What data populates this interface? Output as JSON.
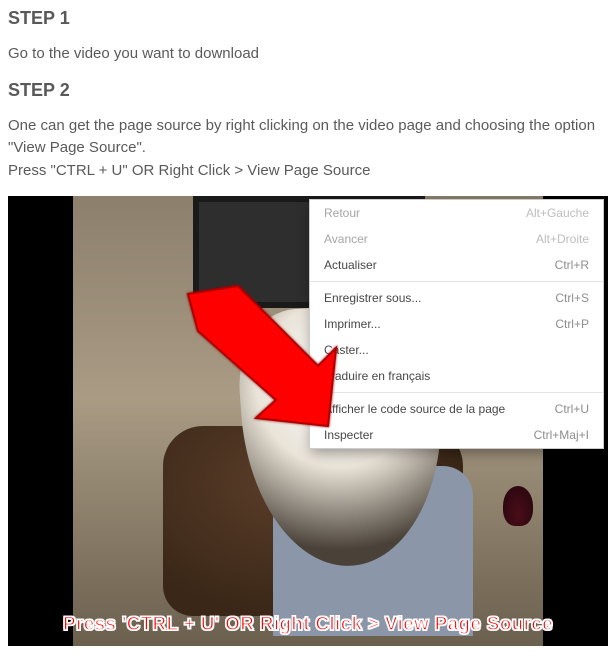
{
  "step1": {
    "heading": "STEP 1",
    "text": "Go to the video you want to download"
  },
  "step2": {
    "heading": "STEP 2",
    "text1": "One can get the page source by right clicking on the video page and choosing the option \"View Page Source\".",
    "text2": "Press \"CTRL + U\" OR Right Click > View Page Source"
  },
  "contextMenu": {
    "items": [
      {
        "label": "Retour",
        "shortcut": "Alt+Gauche",
        "disabled": true
      },
      {
        "label": "Avancer",
        "shortcut": "Alt+Droite",
        "disabled": true
      },
      {
        "label": "Actualiser",
        "shortcut": "Ctrl+R",
        "disabled": false
      }
    ],
    "items2": [
      {
        "label": "Enregistrer sous...",
        "shortcut": "Ctrl+S",
        "disabled": false
      },
      {
        "label": "Imprimer...",
        "shortcut": "Ctrl+P",
        "disabled": false
      },
      {
        "label": "Caster...",
        "shortcut": "",
        "disabled": false
      },
      {
        "label": "Traduire en français",
        "shortcut": "",
        "disabled": false
      }
    ],
    "items3": [
      {
        "label": "Afficher le code source de la page",
        "shortcut": "Ctrl+U",
        "disabled": false
      },
      {
        "label": "Inspecter",
        "shortcut": "Ctrl+Maj+I",
        "disabled": false
      }
    ]
  },
  "caption": "Press 'CTRL + U' OR Right Click > View Page Source",
  "arrowColor": "#ff0000"
}
